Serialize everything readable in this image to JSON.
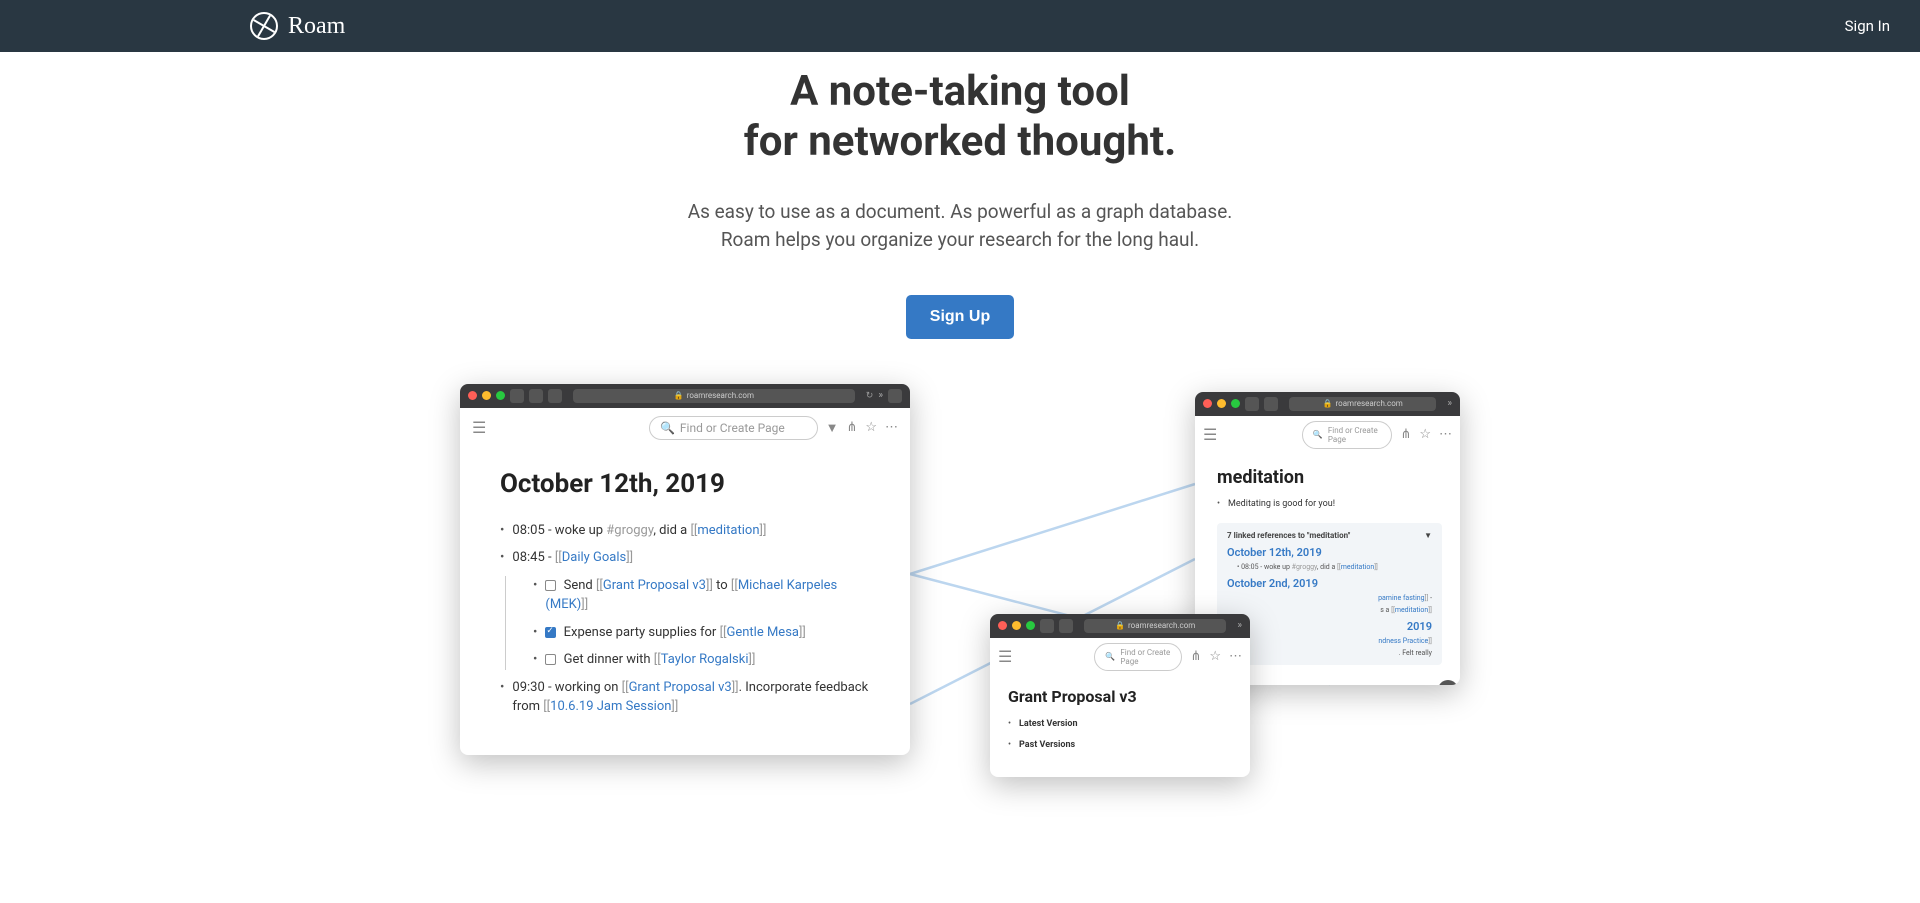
{
  "nav": {
    "brand": "Roam",
    "signin": "Sign In"
  },
  "hero": {
    "headline_l1": "A note-taking tool",
    "headline_l2": "for networked thought.",
    "sub_l1": "As easy to use as a document. As powerful as a graph database.",
    "sub_l2": "Roam helps you organize your research for the long haul.",
    "signup": "Sign Up"
  },
  "url": "roamresearch.com",
  "search_ph": "Find or Create Page",
  "main": {
    "title": "October 12th, 2019",
    "b1_pre": "08:05 - woke up ",
    "b1_tag": "#groggy",
    "b1_mid": ", did a ",
    "b1_link": "meditation",
    "b2_pre": "08:45 - ",
    "b2_link": "Daily Goals",
    "b2a_pre": " Send ",
    "b2a_l1": "Grant Proposal v3",
    "b2a_mid": " to ",
    "b2a_l2": "Michael Karpeles (MEK)",
    "b2b_pre": " Expense party supplies for ",
    "b2b_l1": "Gentle Mesa",
    "b2c_pre": " Get dinner with ",
    "b2c_l1": "Taylor Rogalski",
    "b3_pre": "09:30 - working on ",
    "b3_l1": "Grant Proposal v3",
    "b3_mid": ". Incorporate feedback from ",
    "b3_l2": "10.6.19 Jam Session"
  },
  "med": {
    "title": "meditation",
    "line1": "Meditating is good for you!",
    "refhdr": "7 linked references to \"meditation\"",
    "d1": "October 12th, 2019",
    "d1_line_pre": "08:05 - woke up ",
    "d1_line_tag": "#groggy",
    "d1_line_mid": ", did a ",
    "d1_line_link": "meditation",
    "d2": "October 2nd, 2019",
    "d2_frag1": "pamine fasting",
    "d2_frag2_pre": "s a ",
    "d2_frag2_link": "meditation",
    "d3_frag": "2019",
    "d4_frag1": "ndness Practice",
    "d4_frag2": ". Felt really"
  },
  "gp": {
    "title": "Grant Proposal v3",
    "b1": "Latest Version",
    "b2": "Past Versions"
  }
}
